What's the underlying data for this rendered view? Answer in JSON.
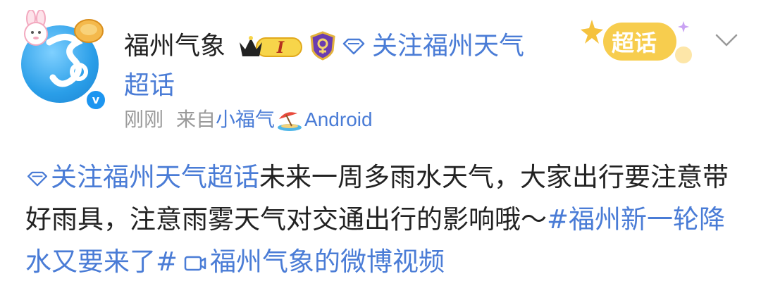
{
  "post": {
    "author": {
      "name": "福州气象",
      "level_badge": "I",
      "avatar_icon": "fu-character-avatar-icon",
      "verified_mark": "v"
    },
    "topic_follow": {
      "label_line1": "关注福州天气",
      "label_line2": "超话"
    },
    "meta": {
      "time": "刚刚",
      "from_prefix": "来自",
      "app": "小福气",
      "platform": "Android"
    },
    "super_topic_badge": "超话",
    "content": {
      "topic_link": "关注福州天气超话",
      "text": "未来一周多雨水天气，大家出行要注意带好雨具，注意雨雾天气对交通出行的影响哦～",
      "hashtag": "#福州新一轮降水又要来了#",
      "video_link": "福州气象的微博视频"
    }
  },
  "colors": {
    "link": "#4a7cd6",
    "text": "#222222",
    "meta": "#9a9a9a"
  }
}
